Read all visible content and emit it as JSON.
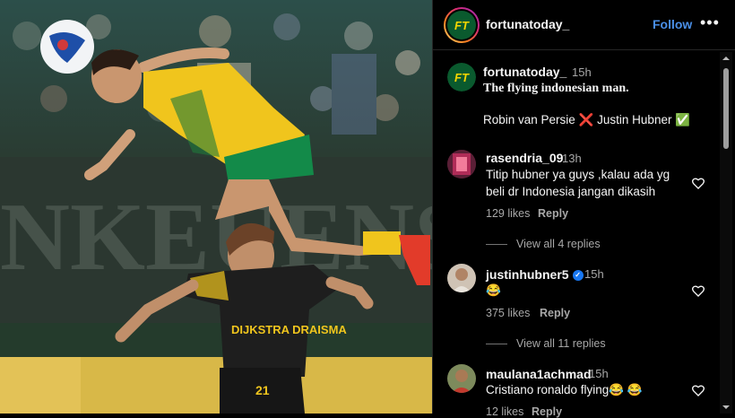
{
  "post": {
    "author": "fortunatoday_",
    "follow_label": "Follow",
    "more_label": "•••",
    "caption_time": "15h",
    "caption_line1": "The flying indonesian man.",
    "caption_line2a": "Robin van Persie",
    "caption_line2b": "Justin Hubner",
    "cross_emoji": "❌",
    "check_emoji": "✅",
    "logo_text": "FT"
  },
  "photo": {
    "board_text": "NKEUENS",
    "jersey_sponsor": "DIJKSTRA DRAISMA",
    "jersey_number": "21"
  },
  "comments": [
    {
      "user": "rasendria_09",
      "time": "13h",
      "line1": "Titip hubner ya guys ,kalau ada yg",
      "line2": "beli dr Indonesia jangan dikasih",
      "likes": "129 likes",
      "reply": "Reply",
      "view_replies": "View all 4 replies"
    },
    {
      "user": "justinhubner5",
      "verified": true,
      "time": "15h",
      "line1": "😂",
      "likes": "375 likes",
      "reply": "Reply",
      "view_replies": "View all 11 replies"
    },
    {
      "user": "maulana1achmad",
      "time": "15h",
      "line1": "Cristiano ronaldo flying😂 😂",
      "likes": "12 likes",
      "reply": "Reply"
    }
  ],
  "colors": {
    "accent": "#4a8fe7",
    "logo_green": "#0a5a2e",
    "logo_yellow": "#f6d500"
  }
}
